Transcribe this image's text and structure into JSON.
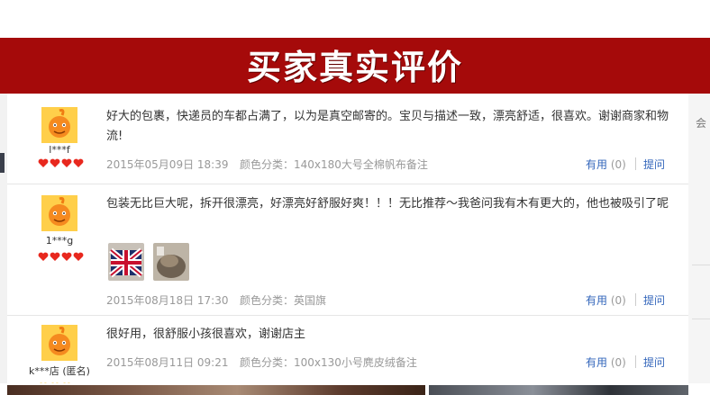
{
  "banner": {
    "title": "买家真实评价"
  },
  "side_right": {
    "text": "会"
  },
  "reviews": [
    {
      "user": "l***f",
      "content": "好大的包裹，快递员的车都占满了，以为是真空邮寄的。宝贝与描述一致，漂亮舒适，很喜欢。谢谢商家和物流!",
      "date": "2015年05月09日 18:39",
      "sku": "颜色分类：140x180大号全棉帆布备注",
      "useful_label": "有用",
      "useful_count": "(0)",
      "ask_label": "提问"
    },
    {
      "user": "1***g",
      "content": "包装无比巨大呢，拆开很漂亮，好漂亮好舒服好爽！！！无比推荐～我爸问我有木有更大的，他也被吸引了呢",
      "date": "2015年08月18日 17:30",
      "sku": "颜色分类：英国旗",
      "useful_label": "有用",
      "useful_count": "(0)",
      "ask_label": "提问"
    },
    {
      "user": "k***店 (匿名)",
      "content": "很好用，很舒服小孩很喜欢，谢谢店主",
      "date": "2015年08月11日 09:21",
      "sku": "颜色分类：100x130小号麂皮绒备注",
      "useful_label": "有用",
      "useful_count": "(0)",
      "ask_label": "提问"
    }
  ],
  "colors": {
    "banner": "#a50a0a",
    "link": "#3366bb",
    "meta": "#999999",
    "heart": "#e8281e"
  }
}
